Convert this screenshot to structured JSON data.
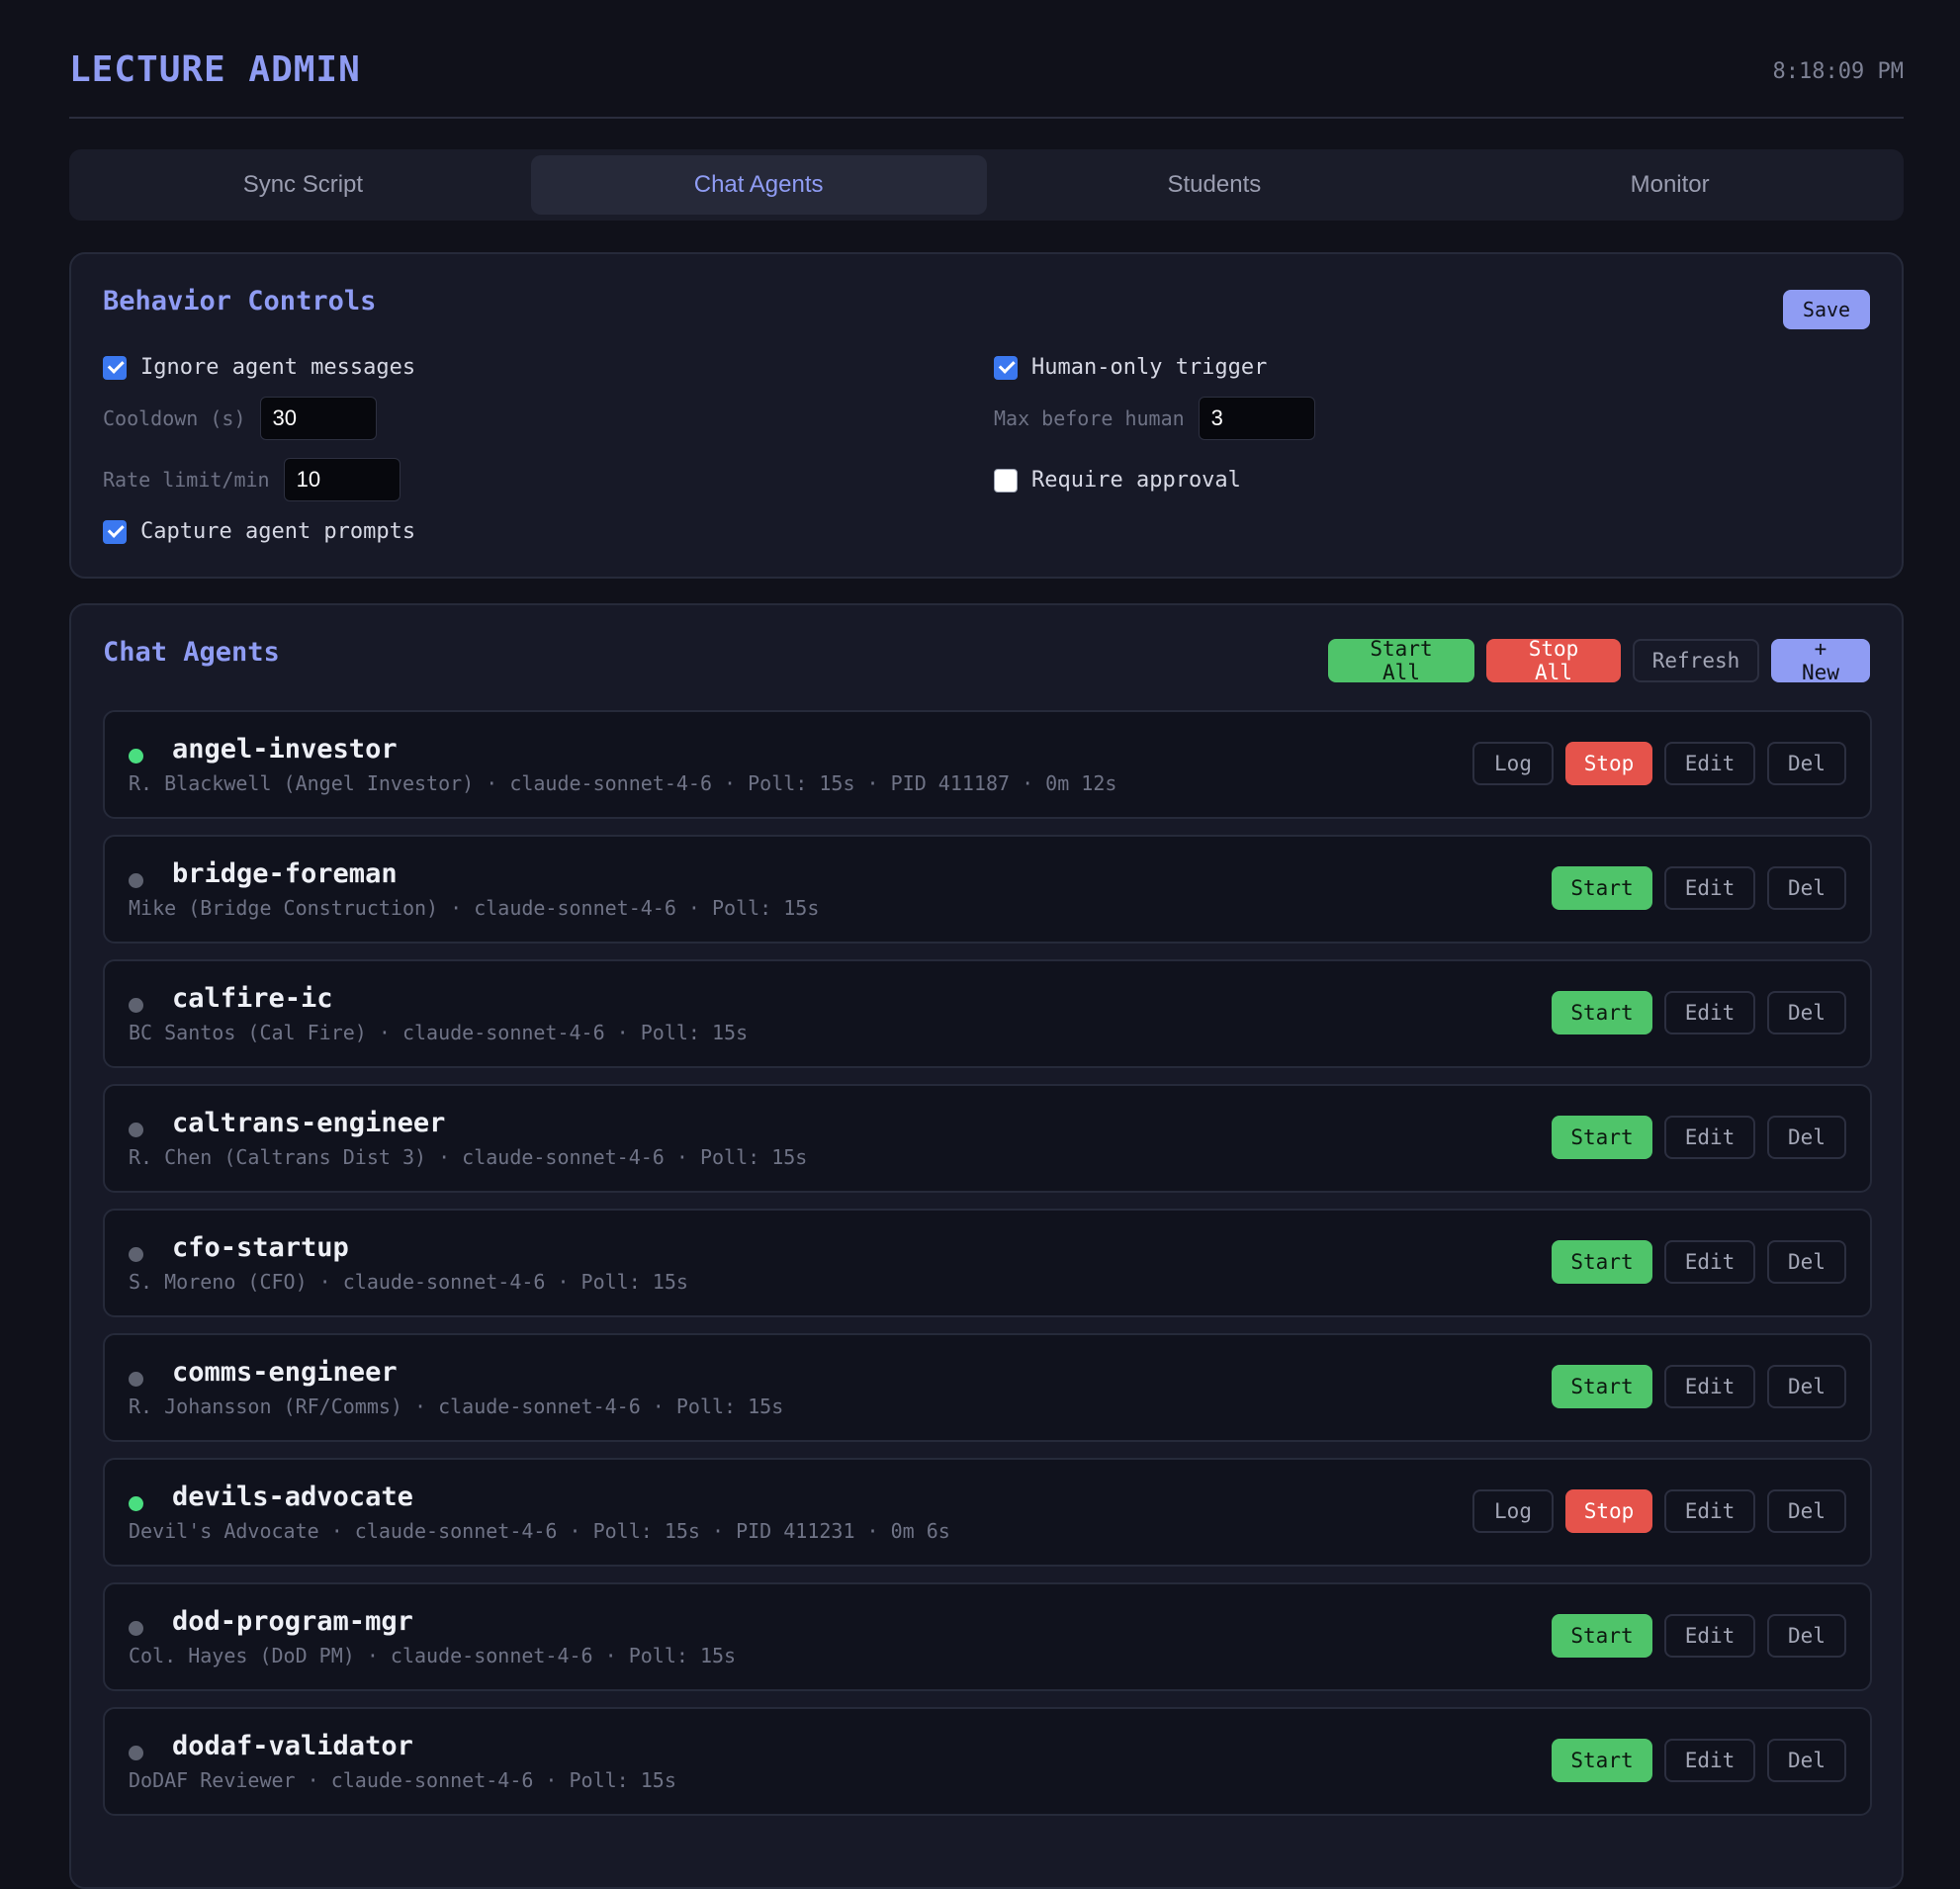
{
  "header": {
    "title": "LECTURE ADMIN",
    "clock": "8:18:09 PM"
  },
  "tabs": [
    {
      "label": "Sync Script",
      "active": false
    },
    {
      "label": "Chat Agents",
      "active": true
    },
    {
      "label": "Students",
      "active": false
    },
    {
      "label": "Monitor",
      "active": false
    }
  ],
  "behavior": {
    "title": "Behavior Controls",
    "save_label": "Save",
    "ignore_agent_messages": {
      "label": "Ignore agent messages",
      "checked": true
    },
    "human_only_trigger": {
      "label": "Human-only trigger",
      "checked": true
    },
    "cooldown": {
      "label": "Cooldown (s)",
      "value": "30"
    },
    "max_before_human": {
      "label": "Max before human",
      "value": "3"
    },
    "rate_limit": {
      "label": "Rate limit/min",
      "value": "10"
    },
    "require_approval": {
      "label": "Require approval",
      "checked": false
    },
    "capture_prompts": {
      "label": "Capture agent prompts",
      "checked": true
    }
  },
  "agents_panel": {
    "title": "Chat Agents",
    "start_all": "Start All",
    "stop_all": "Stop All",
    "refresh": "Refresh",
    "new": "+ New",
    "btn_log": "Log",
    "btn_stop": "Stop",
    "btn_start": "Start",
    "btn_edit": "Edit",
    "btn_del": "Del"
  },
  "agents": [
    {
      "name": "angel-investor",
      "meta": "R. Blackwell (Angel Investor) · claude-sonnet-4-6 · Poll: 15s · PID 411187 · 0m 12s",
      "running": true
    },
    {
      "name": "bridge-foreman",
      "meta": "Mike (Bridge Construction) · claude-sonnet-4-6 · Poll: 15s",
      "running": false
    },
    {
      "name": "calfire-ic",
      "meta": "BC Santos (Cal Fire) · claude-sonnet-4-6 · Poll: 15s",
      "running": false
    },
    {
      "name": "caltrans-engineer",
      "meta": "R. Chen (Caltrans Dist 3) · claude-sonnet-4-6 · Poll: 15s",
      "running": false
    },
    {
      "name": "cfo-startup",
      "meta": "S. Moreno (CFO) · claude-sonnet-4-6 · Poll: 15s",
      "running": false
    },
    {
      "name": "comms-engineer",
      "meta": "R. Johansson (RF/Comms) · claude-sonnet-4-6 · Poll: 15s",
      "running": false
    },
    {
      "name": "devils-advocate",
      "meta": "Devil's Advocate · claude-sonnet-4-6 · Poll: 15s · PID 411231 · 0m 6s",
      "running": true
    },
    {
      "name": "dod-program-mgr",
      "meta": "Col. Hayes (DoD PM) · claude-sonnet-4-6 · Poll: 15s",
      "running": false
    },
    {
      "name": "dodaf-validator",
      "meta": "DoDAF Reviewer · claude-sonnet-4-6 · Poll: 15s",
      "running": false
    }
  ]
}
